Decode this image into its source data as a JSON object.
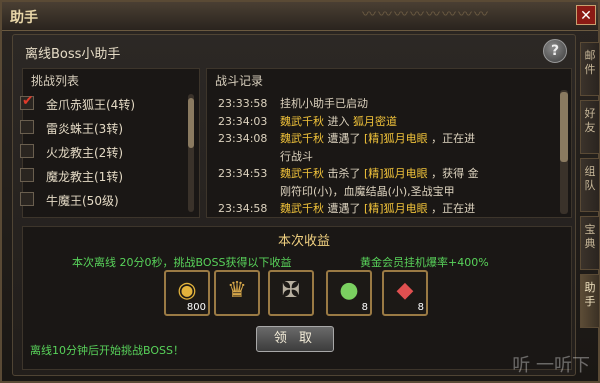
{
  "window": {
    "title": "助手",
    "close_label": "✕"
  },
  "panel": {
    "title": "离线Boss小助手",
    "help_label": "?"
  },
  "challenge_list": {
    "header": "挑战列表",
    "items": [
      {
        "label": "金爪赤狐王(4转)",
        "checked": true
      },
      {
        "label": "雷炎蛛王(3转)",
        "checked": false
      },
      {
        "label": "火龙教主(2转)",
        "checked": false
      },
      {
        "label": "魔龙教主(1转)",
        "checked": false
      },
      {
        "label": "牛魔王(50级)",
        "checked": false
      }
    ]
  },
  "battle_log": {
    "header": "战斗记录",
    "rows": [
      {
        "time": "23:33:58",
        "parts": [
          {
            "t": "挂机小助手已启动",
            "c": "w"
          }
        ]
      },
      {
        "time": "23:34:03",
        "parts": [
          {
            "t": "魏武千秋",
            "c": "g"
          },
          {
            "t": "  进入  ",
            "c": "w"
          },
          {
            "t": "狐月密道",
            "c": "g"
          }
        ]
      },
      {
        "time": "23:34:08",
        "parts": [
          {
            "t": "魏武千秋",
            "c": "g"
          },
          {
            "t": " 遭遇了 ",
            "c": "w"
          },
          {
            "t": "[精]狐月电眼",
            "c": "g"
          },
          {
            "t": " ，正在进",
            "c": "w"
          }
        ]
      },
      {
        "time": "",
        "parts": [
          {
            "t": "行战斗",
            "c": "w"
          }
        ]
      },
      {
        "time": "23:34:53",
        "parts": [
          {
            "t": "魏武千秋",
            "c": "g"
          },
          {
            "t": " 击杀了 ",
            "c": "w"
          },
          {
            "t": "[精]狐月电眼",
            "c": "g"
          },
          {
            "t": " ，获得 金",
            "c": "w"
          }
        ]
      },
      {
        "time": "",
        "parts": [
          {
            "t": "刚符印(小)，血魔结晶(小),圣战宝甲",
            "c": "w"
          }
        ]
      },
      {
        "time": "23:34:58",
        "parts": [
          {
            "t": "魏武千秋",
            "c": "g"
          },
          {
            "t": " 遭遇了 ",
            "c": "w"
          },
          {
            "t": "[精]狐月电眼",
            "c": "g"
          },
          {
            "t": " ，正在进",
            "c": "w"
          }
        ]
      }
    ]
  },
  "rewards": {
    "title": "本次收益",
    "left_text": "本次离线 20分0秒，挑战BOSS获得以下收益",
    "right_text": "黄金会员挂机爆率+400%",
    "items": [
      {
        "icon": "gold-coin-icon",
        "count": "800"
      },
      {
        "icon": "wing-emblem-icon",
        "count": ""
      },
      {
        "icon": "rune-icon",
        "count": ""
      },
      {
        "icon": "green-orb-icon",
        "count": "8"
      },
      {
        "icon": "red-crystal-icon",
        "count": "8"
      }
    ]
  },
  "claim_button": "领 取",
  "footer": "离线10分钟后开始挑战BOSS！",
  "side_tabs": [
    "邮件",
    "好友",
    "组队",
    "宝典",
    "助手"
  ],
  "watermark": "听 一听下"
}
